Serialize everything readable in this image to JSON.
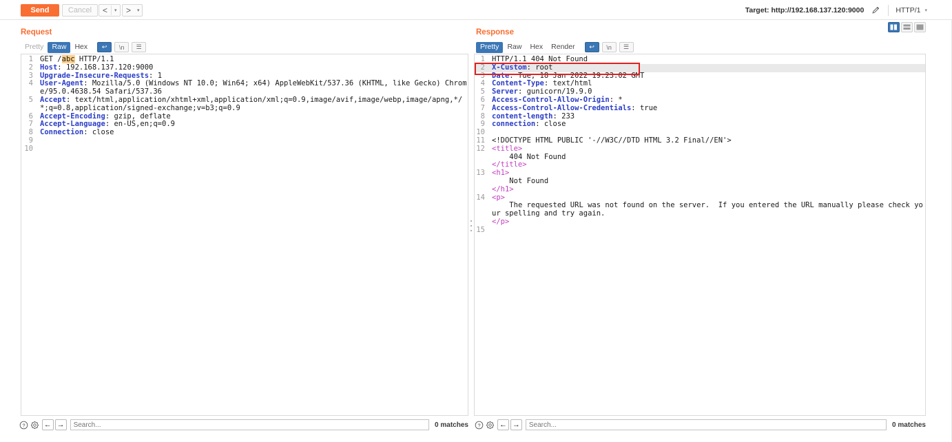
{
  "toolbar": {
    "send_label": "Send",
    "cancel_label": "Cancel",
    "prev_label": "<",
    "next_label": ">",
    "caret": "▾",
    "target_label": "Target: http://192.168.137.120:9000",
    "edit_icon": "pencil-icon",
    "http_version": "HTTP/1",
    "http_caret": "▾"
  },
  "request": {
    "title": "Request",
    "tabs": [
      {
        "label": "Pretty",
        "selected": false,
        "dim": true
      },
      {
        "label": "Raw",
        "selected": true,
        "dim": false
      },
      {
        "label": "Hex",
        "selected": false,
        "dim": false
      }
    ],
    "tool_buttons": [
      {
        "name": "word-wrap-icon",
        "glyph": "↩",
        "selected": true
      },
      {
        "name": "show-newlines-icon",
        "glyph": "\\n",
        "selected": false
      },
      {
        "name": "menu-icon",
        "glyph": "☰",
        "selected": false
      }
    ],
    "lines": [
      {
        "n": "1",
        "parts": [
          {
            "t": "GET ",
            "c": ""
          },
          {
            "t": "/",
            "c": ""
          },
          {
            "t": "abc",
            "c": "hlx"
          },
          {
            "t": " HTTP/1.1",
            "c": ""
          }
        ]
      },
      {
        "n": "2",
        "parts": [
          {
            "t": "Host",
            "c": "hdr"
          },
          {
            "t": ": 192.168.137.120:9000",
            "c": ""
          }
        ]
      },
      {
        "n": "3",
        "parts": [
          {
            "t": "Upgrade-Insecure-Requests",
            "c": "hdr"
          },
          {
            "t": ": 1",
            "c": ""
          }
        ]
      },
      {
        "n": "4",
        "parts": [
          {
            "t": "User-Agent",
            "c": "hdr"
          },
          {
            "t": ": Mozilla/5.0 (Windows NT 10.0; Win64; x64) AppleWebKit/537.36 (KHTML, like Gecko) Chrome/95.0.4638.54 Safari/537.36",
            "c": ""
          }
        ]
      },
      {
        "n": "5",
        "parts": [
          {
            "t": "Accept",
            "c": "hdr"
          },
          {
            "t": ": text/html,application/xhtml+xml,application/xml;q=0.9,image/avif,image/webp,image/apng,*/*;q=0.8,application/signed-exchange;v=b3;q=0.9",
            "c": ""
          }
        ]
      },
      {
        "n": "6",
        "parts": [
          {
            "t": "Accept-Encoding",
            "c": "hdr"
          },
          {
            "t": ": gzip, deflate",
            "c": ""
          }
        ]
      },
      {
        "n": "7",
        "parts": [
          {
            "t": "Accept-Language",
            "c": "hdr"
          },
          {
            "t": ": en-US,en;q=0.9",
            "c": ""
          }
        ]
      },
      {
        "n": "8",
        "parts": [
          {
            "t": "Connection",
            "c": "hdr"
          },
          {
            "t": ": close",
            "c": ""
          }
        ]
      },
      {
        "n": "9",
        "parts": [
          {
            "t": "",
            "c": ""
          }
        ]
      },
      {
        "n": "10",
        "parts": [
          {
            "t": "",
            "c": ""
          }
        ]
      }
    ],
    "status": {
      "help_icon": "help-icon",
      "settings_icon": "gear-icon",
      "prev_match": "←",
      "next_match": "→",
      "search_placeholder": "Search...",
      "search_value": "",
      "matches": "0 matches"
    }
  },
  "response": {
    "title": "Response",
    "tabs": [
      {
        "label": "Pretty",
        "selected": true,
        "dim": false
      },
      {
        "label": "Raw",
        "selected": false,
        "dim": false
      },
      {
        "label": "Hex",
        "selected": false,
        "dim": false
      },
      {
        "label": "Render",
        "selected": false,
        "dim": false
      }
    ],
    "tool_buttons": [
      {
        "name": "word-wrap-icon",
        "glyph": "↩",
        "selected": true
      },
      {
        "name": "show-newlines-icon",
        "glyph": "\\n",
        "selected": false
      },
      {
        "name": "menu-icon",
        "glyph": "☰",
        "selected": false
      }
    ],
    "annotation": {
      "color": "#e02020",
      "target_line": "2"
    },
    "lines": [
      {
        "n": "1",
        "hl": false,
        "parts": [
          {
            "t": "HTTP/1.1 404 Not Found",
            "c": ""
          }
        ]
      },
      {
        "n": "2",
        "hl": true,
        "parts": [
          {
            "t": "X-Custom",
            "c": "hdr"
          },
          {
            "t": ": root",
            "c": ""
          }
        ]
      },
      {
        "n": "3",
        "hl": false,
        "parts": [
          {
            "t": "Date",
            "c": "hdr"
          },
          {
            "t": ": Tue, 18 Jan 2022 19:23:02 GMT",
            "c": ""
          }
        ]
      },
      {
        "n": "4",
        "hl": false,
        "parts": [
          {
            "t": "Content-Type",
            "c": "hdr"
          },
          {
            "t": ": text/html",
            "c": ""
          }
        ]
      },
      {
        "n": "5",
        "hl": false,
        "parts": [
          {
            "t": "Server",
            "c": "hdr"
          },
          {
            "t": ": gunicorn/19.9.0",
            "c": ""
          }
        ]
      },
      {
        "n": "6",
        "hl": false,
        "parts": [
          {
            "t": "Access-Control-Allow-Origin",
            "c": "hdr"
          },
          {
            "t": ": *",
            "c": ""
          }
        ]
      },
      {
        "n": "7",
        "hl": false,
        "parts": [
          {
            "t": "Access-Control-Allow-Credentials",
            "c": "hdr"
          },
          {
            "t": ": true",
            "c": ""
          }
        ]
      },
      {
        "n": "8",
        "hl": false,
        "parts": [
          {
            "t": "content-length",
            "c": "hdr"
          },
          {
            "t": ": 233",
            "c": ""
          }
        ]
      },
      {
        "n": "9",
        "hl": false,
        "parts": [
          {
            "t": "connection",
            "c": "hdr"
          },
          {
            "t": ": close",
            "c": ""
          }
        ]
      },
      {
        "n": "10",
        "hl": false,
        "parts": [
          {
            "t": "",
            "c": ""
          }
        ]
      },
      {
        "n": "11",
        "hl": false,
        "parts": [
          {
            "t": "<!DOCTYPE HTML PUBLIC '-//W3C//DTD HTML 3.2 Final//EN'>",
            "c": ""
          }
        ]
      },
      {
        "n": "12",
        "hl": false,
        "parts": [
          {
            "t": "<title>",
            "c": "tag"
          },
          {
            "t": "\n    404 Not Found\n",
            "c": ""
          },
          {
            "t": "</title>",
            "c": "tag"
          }
        ]
      },
      {
        "n": "13",
        "hl": false,
        "parts": [
          {
            "t": "<h1>",
            "c": "tag"
          },
          {
            "t": "\n    Not Found\n",
            "c": ""
          },
          {
            "t": "</h1>",
            "c": "tag"
          }
        ]
      },
      {
        "n": "14",
        "hl": false,
        "parts": [
          {
            "t": "<p>",
            "c": "tag"
          },
          {
            "t": "\n    The requested URL was not found on the server.  If you entered the URL manually please check your spelling and try again.\n",
            "c": ""
          },
          {
            "t": "</p>",
            "c": "tag"
          }
        ]
      },
      {
        "n": "15",
        "hl": false,
        "parts": [
          {
            "t": "",
            "c": ""
          }
        ]
      }
    ],
    "status": {
      "help_icon": "help-icon",
      "settings_icon": "gear-icon",
      "prev_match": "←",
      "next_match": "→",
      "search_placeholder": "Search...",
      "search_value": "",
      "matches": "0 matches"
    }
  },
  "layout_toggles": [
    {
      "name": "layout-side-by-side",
      "selected": true
    },
    {
      "name": "layout-stacked",
      "selected": false
    },
    {
      "name": "layout-single",
      "selected": false
    }
  ],
  "colors": {
    "accent_orange": "#f96e32",
    "select_blue": "#3b76b5",
    "header_blue": "#2b3ec7",
    "tag_purple": "#c23ec2",
    "annotation_red": "#e02020",
    "highlight_row": "#e9e9e9",
    "highlight_text": "#ffd08a"
  }
}
